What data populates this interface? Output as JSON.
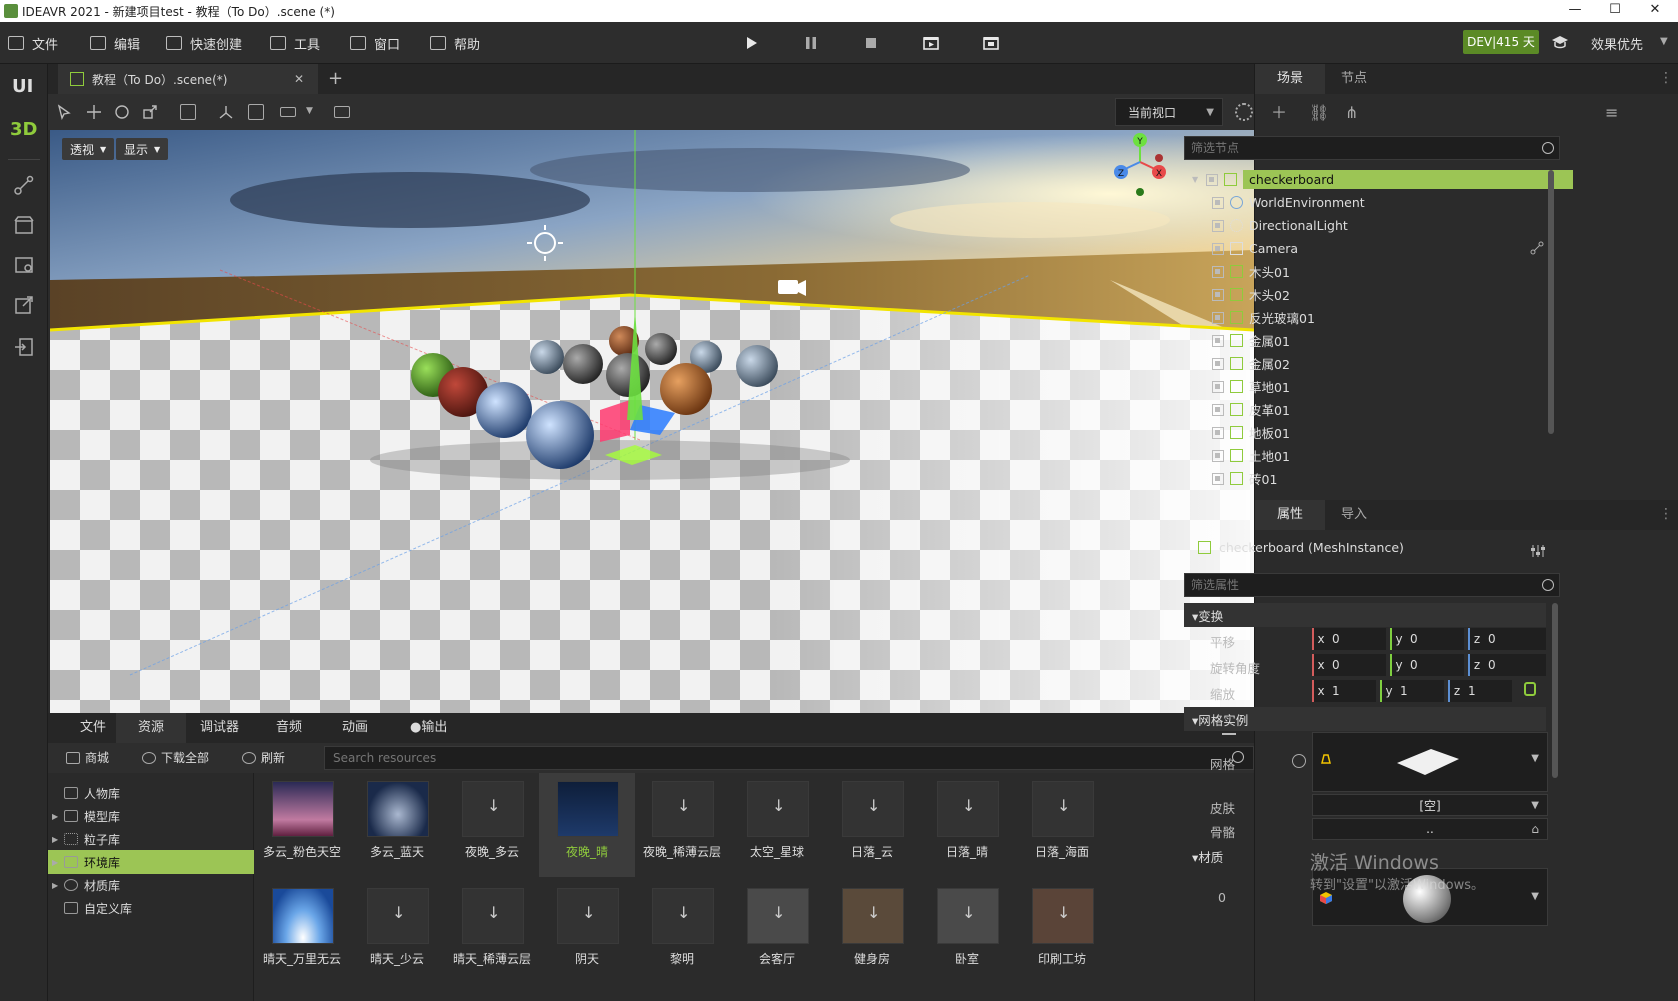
{
  "window": {
    "title": "IDEAVR 2021 - 新建项目test - 教程（To Do）.scene (*)",
    "min": "—",
    "max": "☐",
    "close": "✕"
  },
  "menu": {
    "items": [
      {
        "label": "文件",
        "icon": "folder-icon"
      },
      {
        "label": "编辑",
        "icon": "crop-icon"
      },
      {
        "label": "快速创建",
        "icon": "edit-icon"
      },
      {
        "label": "工具",
        "icon": "window-icon"
      },
      {
        "label": "窗口",
        "icon": "frame-icon"
      },
      {
        "label": "帮助",
        "icon": "help-icon"
      }
    ],
    "dev_badge": "DEV|415 天",
    "quality": "效果优先"
  },
  "leftbar": {
    "ui": "UI",
    "three_d": "3D"
  },
  "scene_tab": {
    "label": "教程（To Do）.scene(*)",
    "close": "✕",
    "add": "+"
  },
  "viewport_toolbar": {
    "current_view": "当前视口",
    "grid": "网格"
  },
  "viewport": {
    "perspective": "透视",
    "display": "显示",
    "gizmo": {
      "y": "Y",
      "x": "X",
      "z": "Z"
    }
  },
  "bottom_tabs": [
    "文件",
    "资源",
    "调试器",
    "音频",
    "动画",
    "●输出"
  ],
  "resource_toolbar": {
    "store": "商城",
    "download_all": "下载全部",
    "refresh": "刷新",
    "search_placeholder": "Search resources"
  },
  "library": [
    {
      "label": "人物库",
      "has_children": false
    },
    {
      "label": "模型库",
      "has_children": true
    },
    {
      "label": "粒子库",
      "has_children": true
    },
    {
      "label": "环境库",
      "has_children": true,
      "selected": true
    },
    {
      "label": "材质库",
      "has_children": true
    },
    {
      "label": "自定义库",
      "has_children": false
    }
  ],
  "resources_row1": [
    "多云_粉色天空",
    "多云_蓝天",
    "夜晚_多云",
    "夜晚_晴",
    "夜晚_稀薄云层",
    "太空_星球",
    "日落_云",
    "日落_晴",
    "日落_海面"
  ],
  "resources_row2": [
    "晴天_万里无云",
    "晴天_少云",
    "晴天_稀薄云层",
    "阴天",
    "黎明",
    "会客厅",
    "健身房",
    "卧室",
    "印刷工坊"
  ],
  "right_panel": {
    "scene_tab": "场景",
    "node_tab": "节点",
    "filter_nodes": "筛选节点",
    "nodes": [
      {
        "label": "checkerboard",
        "type": "mesh",
        "selected": true,
        "expandable": true
      },
      {
        "label": "WorldEnvironment",
        "type": "globe"
      },
      {
        "label": "DirectionalLight",
        "type": "sun"
      },
      {
        "label": "Camera",
        "type": "cam"
      },
      {
        "label": "木头01",
        "type": "mesh"
      },
      {
        "label": "木头02",
        "type": "mesh"
      },
      {
        "label": "反光玻璃01",
        "type": "mesh"
      },
      {
        "label": "金属01",
        "type": "mesh"
      },
      {
        "label": "金属02",
        "type": "mesh"
      },
      {
        "label": "草地01",
        "type": "mesh"
      },
      {
        "label": "皮革01",
        "type": "mesh"
      },
      {
        "label": "地板01",
        "type": "mesh"
      },
      {
        "label": "土地01",
        "type": "mesh"
      },
      {
        "label": "砖01",
        "type": "mesh"
      }
    ],
    "props_tab": "属性",
    "import_tab": "导入",
    "inspector_title": "checkerboard (MeshInstance)",
    "filter_props": "筛选属性",
    "transform": {
      "section": "▾变换",
      "translate": {
        "label": "平移",
        "x": "0",
        "y": "0",
        "z": "0"
      },
      "rotate": {
        "label": "旋转角度",
        "x": "0",
        "y": "0",
        "z": "0"
      },
      "scale": {
        "label": "缩放",
        "x": "1",
        "y": "1",
        "z": "1"
      }
    },
    "mesh_instance": {
      "section": "▾网格实例",
      "mesh_label": "网格",
      "skin_label": "皮肤",
      "skin_value": "[空]",
      "skeleton_label": "骨骼",
      "skeleton_value": ".."
    },
    "material": {
      "section": "▾材质",
      "index": "0"
    },
    "watermark_1": "激活 Windows",
    "watermark_2": "转到\"设置\"以激活Windows。"
  },
  "colors": {
    "accent": "#8fcb3c",
    "selection": "#9cc555",
    "dev_badge": "#5b8a26"
  }
}
